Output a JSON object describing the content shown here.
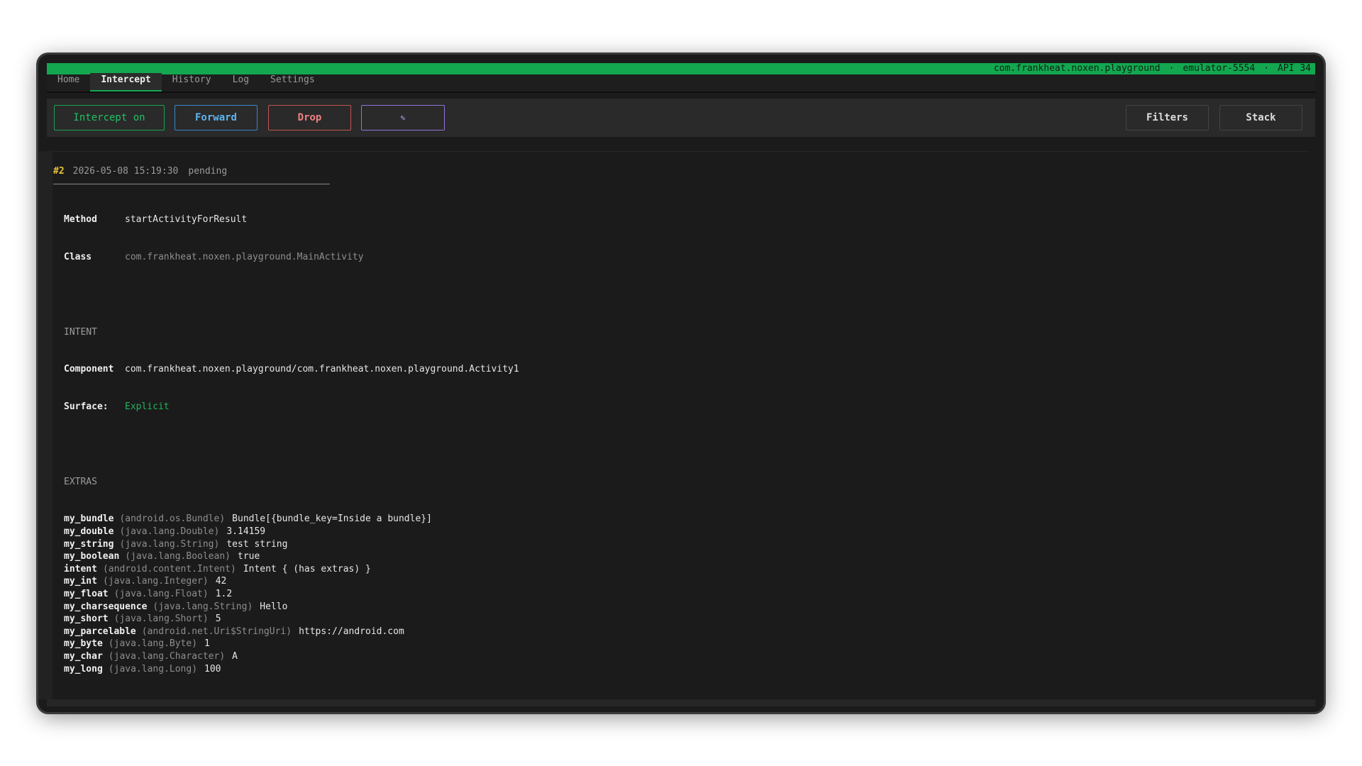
{
  "status": {
    "package": "com.frankheat.noxen.playground",
    "device": "emulator-5554",
    "api": "API 34",
    "separator": "·"
  },
  "tabs": [
    "Home",
    "Intercept",
    "History",
    "Log",
    "Settings"
  ],
  "active_tab": "Intercept",
  "toolbar": {
    "intercept_label": "Intercept on",
    "forward_label": "Forward",
    "drop_label": "Drop",
    "edit_label": "✎",
    "filters_label": "Filters",
    "stack_label": "Stack"
  },
  "colors": {
    "accent": "#13a850",
    "forward": "#3a86c8",
    "drop": "#c05555",
    "edit": "#8f74d8"
  },
  "entry": {
    "id": "#2",
    "timestamp": "2026-05-08 15:19:30",
    "status": "pending",
    "method_key": "Method",
    "method": "startActivityForResult",
    "class_key": "Class",
    "class": "com.frankheat.noxen.playground.MainActivity",
    "intent_heading": "INTENT",
    "component_key": "Component",
    "component": "com.frankheat.noxen.playground/com.frankheat.noxen.playground.Activity1",
    "surface_key": "Surface:",
    "surface": "Explicit",
    "extras_heading": "EXTRAS",
    "extras": [
      {
        "name": "my_bundle",
        "type": "(android.os.Bundle)",
        "value": "Bundle[{bundle_key=Inside a bundle}]"
      },
      {
        "name": "my_double",
        "type": "(java.lang.Double)",
        "value": "3.14159"
      },
      {
        "name": "my_string",
        "type": "(java.lang.String)",
        "value": "test string"
      },
      {
        "name": "my_boolean",
        "type": "(java.lang.Boolean)",
        "value": "true"
      },
      {
        "name": "intent",
        "type": "(android.content.Intent)",
        "value": "Intent { (has extras) }"
      },
      {
        "name": "my_int",
        "type": "(java.lang.Integer)",
        "value": "42"
      },
      {
        "name": "my_float",
        "type": "(java.lang.Float)",
        "value": "1.2"
      },
      {
        "name": "my_charsequence",
        "type": "(java.lang.String)",
        "value": "Hello"
      },
      {
        "name": "my_short",
        "type": "(java.lang.Short)",
        "value": "5"
      },
      {
        "name": "my_parcelable",
        "type": "(android.net.Uri$StringUri)",
        "value": "https://android.com"
      },
      {
        "name": "my_byte",
        "type": "(java.lang.Byte)",
        "value": "1"
      },
      {
        "name": "my_char",
        "type": "(java.lang.Character)",
        "value": "A"
      },
      {
        "name": "my_long",
        "type": "(java.lang.Long)",
        "value": "100"
      }
    ]
  }
}
